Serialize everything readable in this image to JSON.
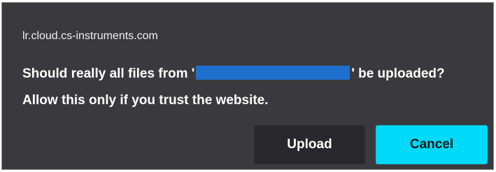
{
  "dialog": {
    "origin": "lr.cloud.cs-instruments.com",
    "message_prefix": "Should really all files from '",
    "message_suffix": "' be uploaded?",
    "message_line2": "Allow this only if you trust the website.",
    "redaction_color": "#1f6fcf"
  },
  "buttons": {
    "upload_label": "Upload",
    "cancel_label": "Cancel"
  },
  "colors": {
    "dialog_background": "#3a3a3e",
    "cancel_accent": "#00d9f7",
    "upload_background": "#28282c"
  }
}
